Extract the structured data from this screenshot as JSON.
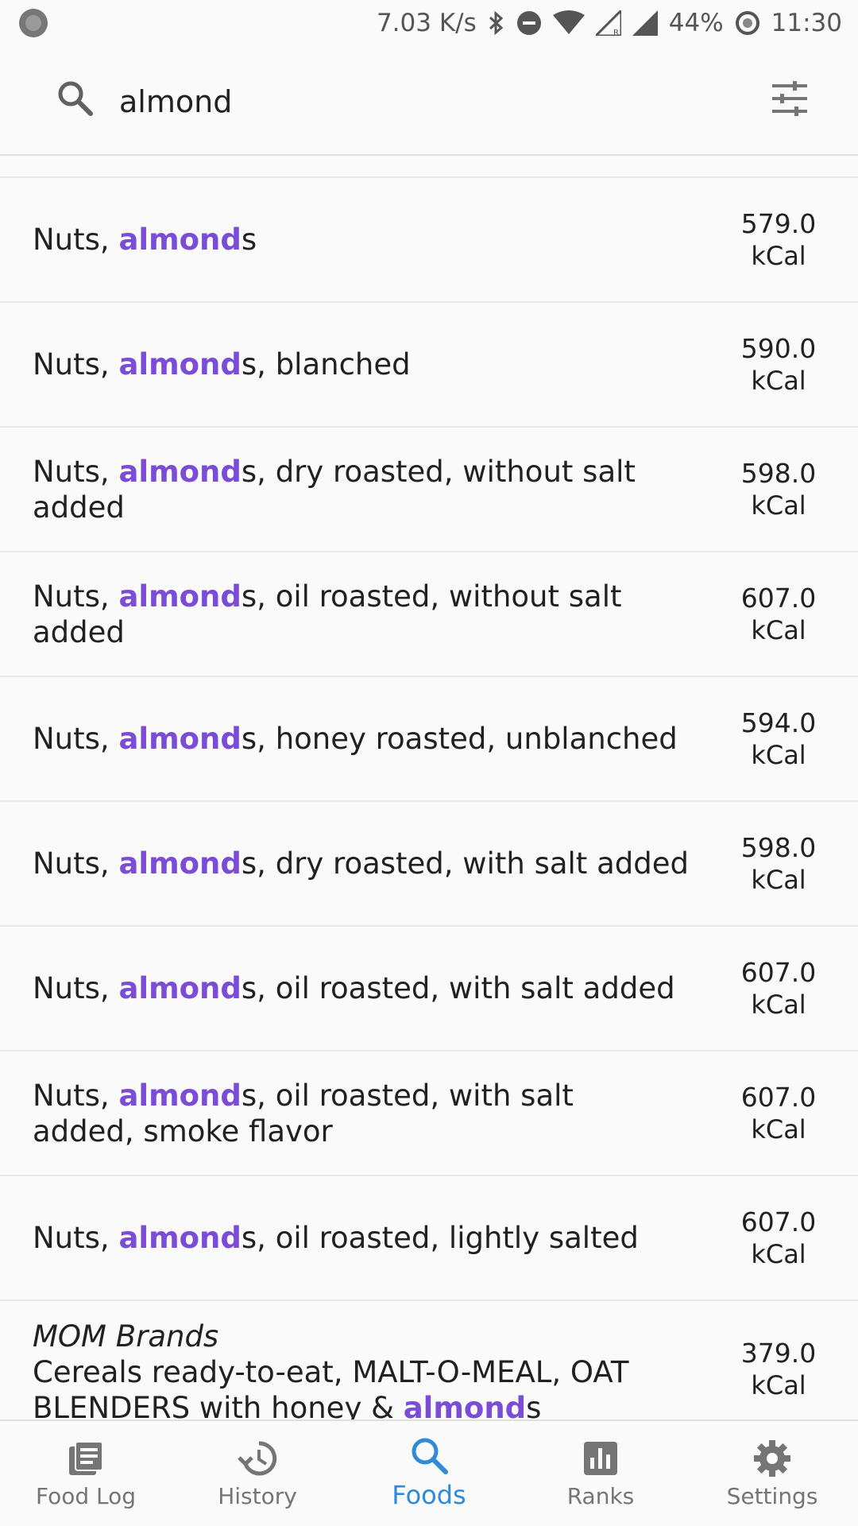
{
  "status_bar": {
    "net_speed": "7.03 K/s",
    "battery": "44%",
    "time": "11:30"
  },
  "search": {
    "query": "almond",
    "placeholder": ""
  },
  "highlight_color": "#7b4cd8",
  "active_tab_color": "#2e8bd8",
  "results": [
    {
      "prefix": "Nuts, ",
      "match": "almond",
      "suffix": "s",
      "kcal": "579.0",
      "unit": "kCal"
    },
    {
      "prefix": "Nuts, ",
      "match": "almond",
      "suffix": "s, blanched",
      "kcal": "590.0",
      "unit": "kCal"
    },
    {
      "prefix": "Nuts, ",
      "match": "almond",
      "suffix": "s, dry roasted, without salt added",
      "kcal": "598.0",
      "unit": "kCal"
    },
    {
      "prefix": "Nuts, ",
      "match": "almond",
      "suffix": "s, oil roasted, without salt added",
      "kcal": "607.0",
      "unit": "kCal"
    },
    {
      "prefix": "Nuts, ",
      "match": "almond",
      "suffix": "s, honey roasted, unblanched",
      "kcal": "594.0",
      "unit": "kCal"
    },
    {
      "prefix": "Nuts, ",
      "match": "almond",
      "suffix": "s, dry roasted, with salt added",
      "kcal": "598.0",
      "unit": "kCal"
    },
    {
      "prefix": "Nuts, ",
      "match": "almond",
      "suffix": "s, oil roasted, with salt added",
      "kcal": "607.0",
      "unit": "kCal"
    },
    {
      "prefix": "Nuts, ",
      "match": "almond",
      "suffix": "s, oil roasted, with salt added, smoke flavor",
      "kcal": "607.0",
      "unit": "kCal"
    },
    {
      "prefix": "Nuts, ",
      "match": "almond",
      "suffix": "s, oil roasted, lightly salted",
      "kcal": "607.0",
      "unit": "kCal"
    },
    {
      "brand": "MOM Brands",
      "prefix": "Cereals ready-to-eat, MALT-O-MEAL, OAT BLENDERS with honey & ",
      "match": "almond",
      "suffix": "s",
      "kcal": "379.0",
      "unit": "kCal"
    }
  ],
  "nav": [
    {
      "label": "Food Log",
      "icon": "food-log-icon",
      "active": false
    },
    {
      "label": "History",
      "icon": "history-icon",
      "active": false
    },
    {
      "label": "Foods",
      "icon": "search-icon",
      "active": true
    },
    {
      "label": "Ranks",
      "icon": "bar-chart-icon",
      "active": false
    },
    {
      "label": "Settings",
      "icon": "gear-icon",
      "active": false
    }
  ]
}
